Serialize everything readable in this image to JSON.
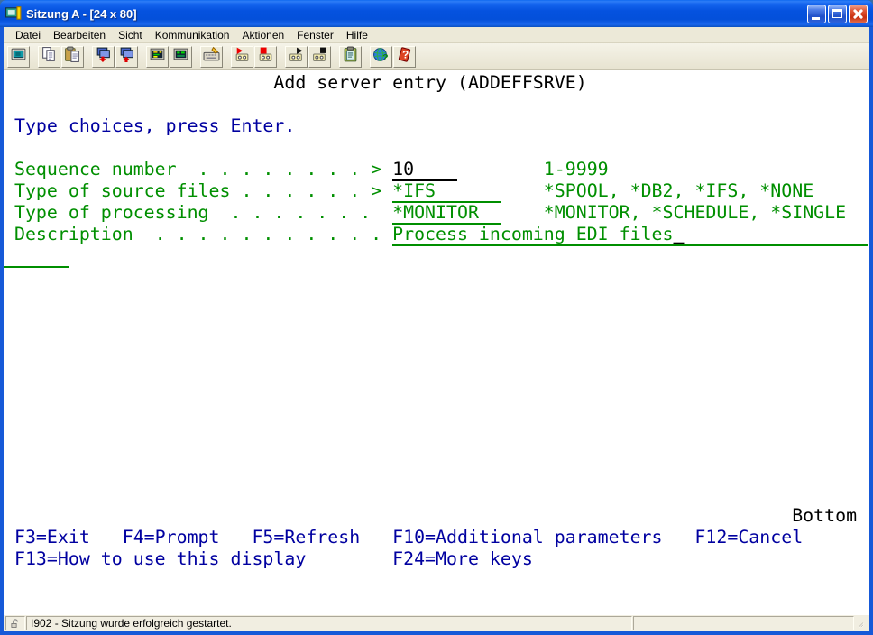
{
  "colors": {
    "terminal_green": "#008f00",
    "terminal_blue": "#0000a0",
    "terminal_black": "#000000",
    "titlebar_blue": "#0552df",
    "close_red": "#c83010"
  },
  "window": {
    "title": "Sitzung A - [24 x 80]",
    "controls": {
      "minimize": "minimize",
      "maximize": "maximize",
      "close": "close"
    }
  },
  "menu": {
    "items": [
      "Datei",
      "Bearbeiten",
      "Sicht",
      "Kommunikation",
      "Aktionen",
      "Fenster",
      "Hilfe"
    ]
  },
  "toolbar": {
    "groups": [
      [
        "session-screen-icon"
      ],
      [
        "copy-icon",
        "paste-icon"
      ],
      [
        "send-file-icon",
        "receive-file-icon"
      ],
      [
        "display-setup-icon",
        "display-colors-icon"
      ],
      [
        "keyboard-setup-icon"
      ],
      [
        "record-macro-icon",
        "stop-record-icon"
      ],
      [
        "play-macro-icon",
        "stop-macro-icon"
      ],
      [
        "clipboard-icon"
      ],
      [
        "web-help-icon",
        "help-icon"
      ]
    ]
  },
  "terminal": {
    "size": "24 x 80",
    "rows": [
      {
        "r": 1,
        "s": [
          {
            "t": "                         ",
            "c": ""
          },
          {
            "t": "Add server entry (ADDEFFSRVE)",
            "c": "k",
            "n": "screen-title"
          }
        ]
      },
      {
        "r": 3,
        "s": [
          {
            "t": " ",
            "c": ""
          },
          {
            "t": "Type choices, press Enter.",
            "c": "b",
            "n": "instruction-line"
          }
        ]
      },
      {
        "r": 5,
        "s": [
          {
            "t": " ",
            "c": ""
          },
          {
            "t": "Sequence number  . . . . . . . . >",
            "c": "g",
            "n": "label-sequence-number"
          },
          {
            "t": " ",
            "c": ""
          },
          {
            "t": "10",
            "c": "ku",
            "n": "field-sequence-number",
            "i": true
          },
          {
            "t": "    ",
            "c": "ku",
            "n": "field-sequence-number-pad",
            "i": true
          },
          {
            "t": "        ",
            "c": ""
          },
          {
            "t": "1-9999",
            "c": "g",
            "n": "allowed-values-sequence-number"
          }
        ]
      },
      {
        "r": 6,
        "s": [
          {
            "t": " ",
            "c": ""
          },
          {
            "t": "Type of source files . . . . . . >",
            "c": "g",
            "n": "label-source-files"
          },
          {
            "t": " ",
            "c": ""
          },
          {
            "t": "*IFS",
            "c": "gu",
            "n": "field-source-files",
            "i": true
          },
          {
            "t": "      ",
            "c": "gu",
            "n": "field-source-files-pad",
            "i": true
          },
          {
            "t": "    ",
            "c": ""
          },
          {
            "t": "*SPOOL, *DB2, *IFS, *NONE",
            "c": "g",
            "n": "allowed-values-source-files"
          }
        ]
      },
      {
        "r": 7,
        "s": [
          {
            "t": " ",
            "c": ""
          },
          {
            "t": "Type of processing  . . . . . . . ",
            "c": "g",
            "n": "label-processing"
          },
          {
            "t": " ",
            "c": ""
          },
          {
            "t": "*MONITOR",
            "c": "gu",
            "n": "field-processing",
            "i": true
          },
          {
            "t": "  ",
            "c": "gu",
            "n": "field-processing-pad",
            "i": true
          },
          {
            "t": "    ",
            "c": ""
          },
          {
            "t": "*MONITOR, *SCHEDULE, *SINGLE",
            "c": "g",
            "n": "allowed-values-processing"
          }
        ]
      },
      {
        "r": 8,
        "s": [
          {
            "t": " ",
            "c": ""
          },
          {
            "t": "Description  . . . . . . . . . . .",
            "c": "g",
            "n": "label-description"
          },
          {
            "t": " ",
            "c": ""
          },
          {
            "t": "Process incoming EDI files",
            "c": "gu",
            "n": "field-description",
            "i": true
          },
          {
            "t": "_",
            "c": "cur",
            "n": "text-cursor",
            "i": true
          },
          {
            "t": "                 ",
            "c": "gu",
            "n": "field-description-pad",
            "i": true
          }
        ]
      },
      {
        "r": 9,
        "s": [
          {
            "t": "      ",
            "c": "gu",
            "n": "field-description-continuation",
            "i": true
          }
        ]
      },
      {
        "r": 21,
        "s": [
          {
            "t": "                                                                         ",
            "c": ""
          },
          {
            "t": "Bottom",
            "c": "k",
            "n": "bottom-marker"
          }
        ]
      },
      {
        "r": 22,
        "s": [
          {
            "t": " ",
            "c": ""
          },
          {
            "t": "F3=Exit   F4=Prompt   F5=Refresh   F10=Additional parameters   F12=Cancel",
            "c": "b",
            "n": "function-keys-line-1"
          }
        ]
      },
      {
        "r": 23,
        "s": [
          {
            "t": " ",
            "c": ""
          },
          {
            "t": "F13=How to use this display        F24=More keys",
            "c": "b",
            "n": "function-keys-line-2"
          }
        ]
      }
    ]
  },
  "statusbar": {
    "message": "I902 - Sitzung wurde erfolgreich gestartet."
  }
}
